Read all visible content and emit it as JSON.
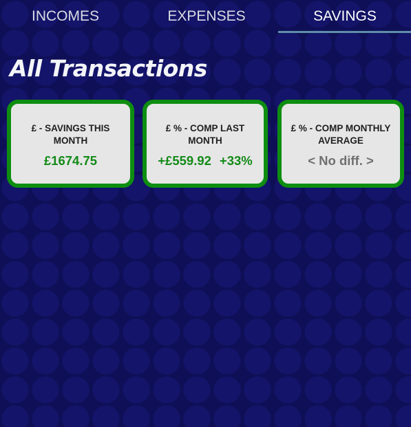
{
  "tabs": [
    {
      "label": "INCOMES",
      "active": false
    },
    {
      "label": "EXPENSES",
      "active": false
    },
    {
      "label": "SAVINGS",
      "active": true
    }
  ],
  "heading": "All Transactions",
  "cards": [
    {
      "title_line1": "£ - SAVINGS THIS",
      "title_line2": "MONTH",
      "value": "£1674.75",
      "value_color": "#138a17"
    },
    {
      "title_line1": "£ % - COMP LAST",
      "title_line2": "MONTH",
      "value": "+£559.92",
      "percent": "+33%",
      "value_color": "#138a17"
    },
    {
      "title_line1": "£ % - COMP MONTHLY",
      "title_line2": "AVERAGE",
      "value": "< No diff. >",
      "value_color": "#6f6f6f"
    }
  ],
  "colors": {
    "background": "#0f0f57",
    "card_border": "#0e8e10",
    "card_fill": "#e6e6e6",
    "tab_indicator": "#5f8fa8"
  }
}
